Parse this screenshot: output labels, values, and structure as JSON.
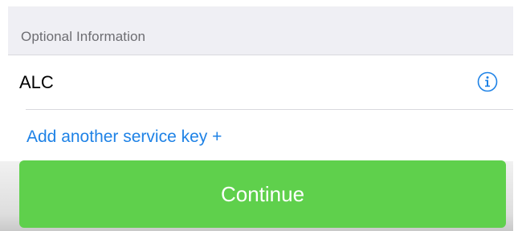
{
  "section": {
    "header_label": "Optional Information"
  },
  "service_key_row": {
    "value": "ALC",
    "icon": "info-circle-icon"
  },
  "add_link": {
    "label": "Add another service key +"
  },
  "continue_button": {
    "label": "Continue"
  },
  "colors": {
    "accent_blue": "#1e82e6",
    "button_green": "#5fd04c",
    "header_gray": "#efeff4"
  }
}
